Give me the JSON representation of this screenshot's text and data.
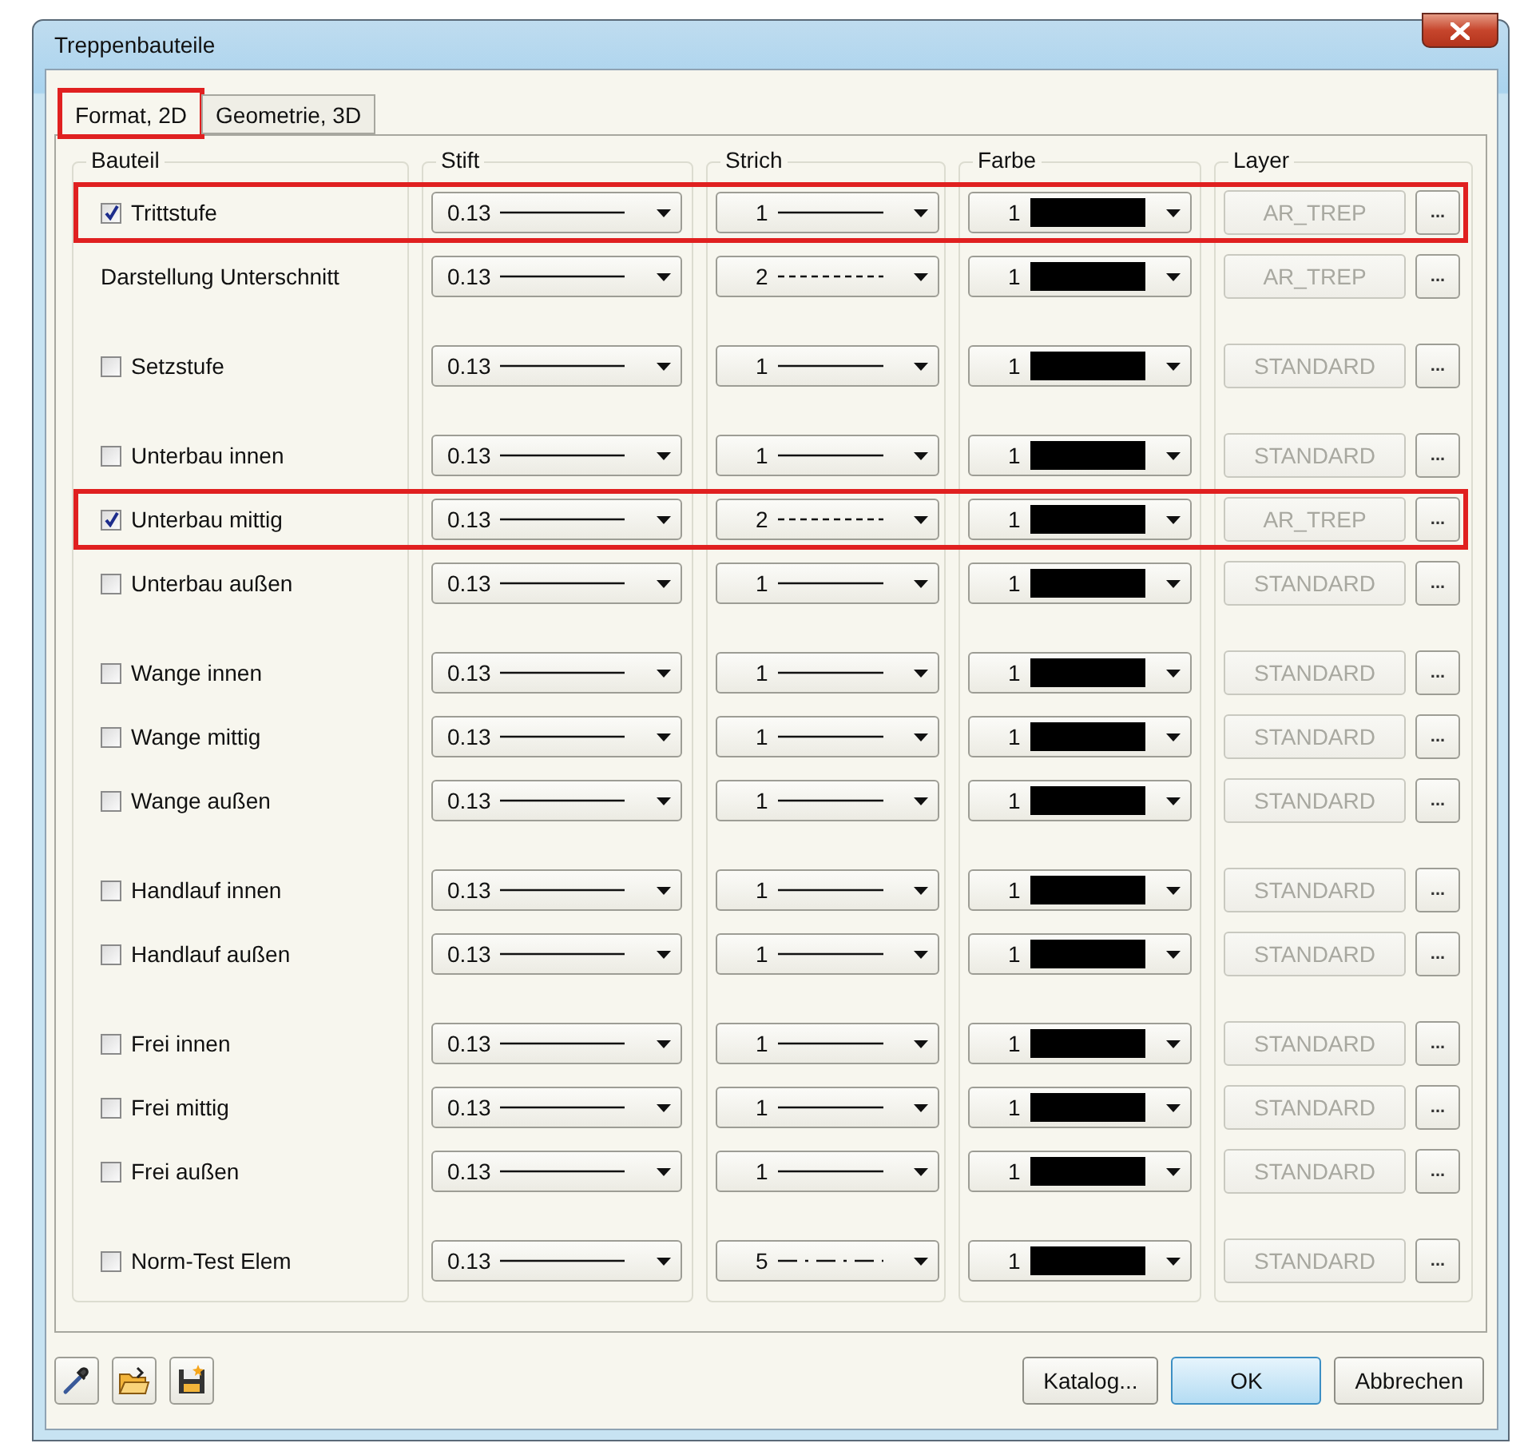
{
  "window": {
    "title": "Treppenbauteile"
  },
  "tabs": [
    {
      "label": "Format, 2D",
      "selected": true,
      "highlighted": true
    },
    {
      "label": "Geometrie, 3D",
      "selected": false,
      "highlighted": false
    }
  ],
  "columns": [
    "Bauteil",
    "Stift",
    "Strich",
    "Farbe",
    "Layer"
  ],
  "groups": [
    {
      "rows": [
        {
          "label": "Trittstufe",
          "kind": "checkbox",
          "checked": true,
          "highlighted": true,
          "pen": "0.13",
          "line": {
            "value": "1",
            "kind": "solid"
          },
          "color_index": "1",
          "layer": "AR_TREP",
          "layer_disabled": true,
          "browse": "..."
        },
        {
          "label": "Darstellung Unterschnitt",
          "kind": "label",
          "highlighted": false,
          "pen": "0.13",
          "line": {
            "value": "2",
            "kind": "dashed"
          },
          "color_index": "1",
          "layer": "AR_TREP",
          "layer_disabled": true,
          "browse": "..."
        }
      ]
    },
    {
      "rows": [
        {
          "label": "Setzstufe",
          "kind": "checkbox",
          "checked": false,
          "highlighted": false,
          "pen": "0.13",
          "line": {
            "value": "1",
            "kind": "solid"
          },
          "color_index": "1",
          "layer": "STANDARD",
          "layer_disabled": true,
          "browse": "..."
        }
      ]
    },
    {
      "rows": [
        {
          "label": "Unterbau innen",
          "kind": "checkbox",
          "checked": false,
          "highlighted": false,
          "pen": "0.13",
          "line": {
            "value": "1",
            "kind": "solid"
          },
          "color_index": "1",
          "layer": "STANDARD",
          "layer_disabled": true,
          "browse": "..."
        },
        {
          "label": "Unterbau mittig",
          "kind": "checkbox",
          "checked": true,
          "highlighted": true,
          "pen": "0.13",
          "line": {
            "value": "2",
            "kind": "dashed"
          },
          "color_index": "1",
          "layer": "AR_TREP",
          "layer_disabled": true,
          "browse": "..."
        },
        {
          "label": "Unterbau außen",
          "kind": "checkbox",
          "checked": false,
          "highlighted": false,
          "pen": "0.13",
          "line": {
            "value": "1",
            "kind": "solid"
          },
          "color_index": "1",
          "layer": "STANDARD",
          "layer_disabled": true,
          "browse": "..."
        }
      ]
    },
    {
      "rows": [
        {
          "label": "Wange innen",
          "kind": "checkbox",
          "checked": false,
          "highlighted": false,
          "pen": "0.13",
          "line": {
            "value": "1",
            "kind": "solid"
          },
          "color_index": "1",
          "layer": "STANDARD",
          "layer_disabled": true,
          "browse": "..."
        },
        {
          "label": "Wange mittig",
          "kind": "checkbox",
          "checked": false,
          "highlighted": false,
          "pen": "0.13",
          "line": {
            "value": "1",
            "kind": "solid"
          },
          "color_index": "1",
          "layer": "STANDARD",
          "layer_disabled": true,
          "browse": "..."
        },
        {
          "label": "Wange außen",
          "kind": "checkbox",
          "checked": false,
          "highlighted": false,
          "pen": "0.13",
          "line": {
            "value": "1",
            "kind": "solid"
          },
          "color_index": "1",
          "layer": "STANDARD",
          "layer_disabled": true,
          "browse": "..."
        }
      ]
    },
    {
      "rows": [
        {
          "label": "Handlauf innen",
          "kind": "checkbox",
          "checked": false,
          "highlighted": false,
          "pen": "0.13",
          "line": {
            "value": "1",
            "kind": "solid"
          },
          "color_index": "1",
          "layer": "STANDARD",
          "layer_disabled": true,
          "browse": "..."
        },
        {
          "label": "Handlauf außen",
          "kind": "checkbox",
          "checked": false,
          "highlighted": false,
          "pen": "0.13",
          "line": {
            "value": "1",
            "kind": "solid"
          },
          "color_index": "1",
          "layer": "STANDARD",
          "layer_disabled": true,
          "browse": "..."
        }
      ]
    },
    {
      "rows": [
        {
          "label": "Frei innen",
          "kind": "checkbox",
          "checked": false,
          "highlighted": false,
          "pen": "0.13",
          "line": {
            "value": "1",
            "kind": "solid"
          },
          "color_index": "1",
          "layer": "STANDARD",
          "layer_disabled": true,
          "browse": "..."
        },
        {
          "label": "Frei mittig",
          "kind": "checkbox",
          "checked": false,
          "highlighted": false,
          "pen": "0.13",
          "line": {
            "value": "1",
            "kind": "solid"
          },
          "color_index": "1",
          "layer": "STANDARD",
          "layer_disabled": true,
          "browse": "..."
        },
        {
          "label": "Frei außen",
          "kind": "checkbox",
          "checked": false,
          "highlighted": false,
          "pen": "0.13",
          "line": {
            "value": "1",
            "kind": "solid"
          },
          "color_index": "1",
          "layer": "STANDARD",
          "layer_disabled": true,
          "browse": "..."
        }
      ]
    },
    {
      "rows": [
        {
          "label": "Norm-Test Elem",
          "kind": "checkbox",
          "checked": false,
          "highlighted": false,
          "pen": "0.13",
          "line": {
            "value": "5",
            "kind": "dashdot"
          },
          "color_index": "1",
          "layer": "STANDARD",
          "layer_disabled": true,
          "browse": "..."
        }
      ]
    }
  ],
  "buttons": [
    {
      "label": "Katalog...",
      "default": false
    },
    {
      "label": "OK",
      "default": true
    },
    {
      "label": "Abbrechen",
      "default": false
    }
  ]
}
